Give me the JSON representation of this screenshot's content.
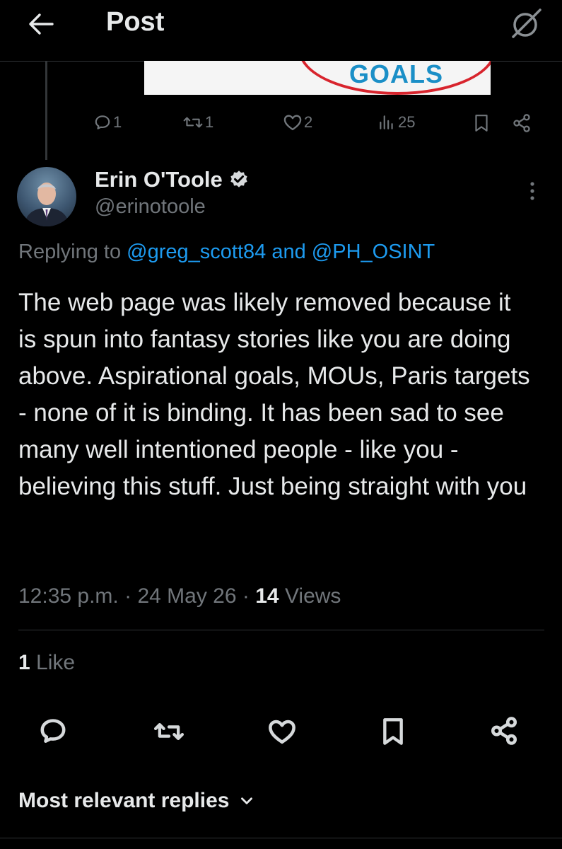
{
  "header": {
    "title": "Post"
  },
  "quoted_media": {
    "text": "GOALS"
  },
  "parent_actions": {
    "replies": "1",
    "reposts": "1",
    "likes": "2",
    "views": "25"
  },
  "post": {
    "author_name": "Erin O'Toole",
    "handle": "@erinotoole",
    "replying_prefix": "Replying to",
    "reply_user_1": "@greg_scott84",
    "reply_and": "and",
    "reply_user_2": "@PH_OSINT",
    "body": "The web page was likely removed because it is spun into fantasy stories like you are doing above. Aspirational goals, MOUs, Paris targets - none of it is binding. It has been sad to see many well intentioned people - like you - believing this stuff. Just being straight with you",
    "time": "12:35 p.m.",
    "separator": "·",
    "date": "24 May 26",
    "views_count": "14",
    "views_label": "Views",
    "likes_count": "1",
    "likes_label": "Like"
  },
  "replies_filter": {
    "label": "Most relevant replies"
  },
  "colors": {
    "background": "#000000",
    "text": "#e7e9ea",
    "muted": "#71767b",
    "link": "#1d9bf0",
    "verified_badge": "#d6d9db"
  }
}
